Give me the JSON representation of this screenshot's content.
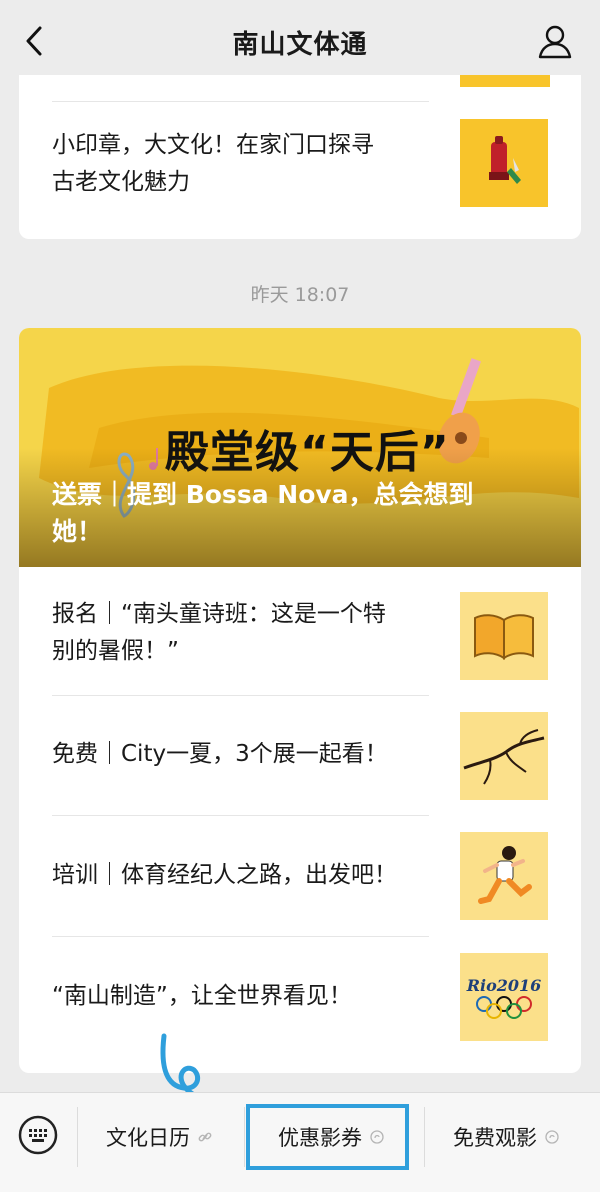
{
  "header": {
    "title": "南山文体通",
    "back_icon": "chevron-left-icon",
    "profile_icon": "user-icon"
  },
  "top_card": {
    "article": {
      "title_line1": "小印章，大文化！在家门口探寻",
      "title_line2": "古老文化魅力",
      "thumb_icon": "stamp-icon",
      "thumb_color": "#f8c42b"
    }
  },
  "timestamp": "昨天 18:07",
  "main_card": {
    "banner": {
      "headline": "殿堂级“天后”",
      "caption": "送票｜提到 Bossa Nova，总会想到她！",
      "bg_color": "#f5d54a"
    },
    "articles": [
      {
        "title_line1": "报名｜“南头童诗班：这是一个特",
        "title_line2": "别的暑假！”",
        "thumb_icon": "open-book-icon",
        "thumb_color": "#fbe08a"
      },
      {
        "title_line1": "免费｜City一夏，3个展一起看！",
        "title_line2": "",
        "thumb_icon": "ink-branch-icon",
        "thumb_color": "#fbe08a"
      },
      {
        "title_line1": "培训｜体育经纪人之路，出发吧！",
        "title_line2": "",
        "thumb_icon": "runner-icon",
        "thumb_color": "#fbe08a"
      },
      {
        "title_line1": "“南山制造”，让全世界看见！",
        "title_line2": "",
        "thumb_icon": "rio2016-olympic-icon",
        "thumb_label": "Rio2016",
        "thumb_color": "#fbe08a"
      }
    ]
  },
  "menu": {
    "keyboard_icon": "keyboard-icon",
    "items": [
      {
        "label": "文化日历",
        "icon": "link-icon"
      },
      {
        "label": "优惠影券",
        "icon": "mini-program-icon"
      },
      {
        "label": "免费观影",
        "icon": "mini-program-icon"
      }
    ],
    "highlight_color": "#2f9fdc"
  }
}
